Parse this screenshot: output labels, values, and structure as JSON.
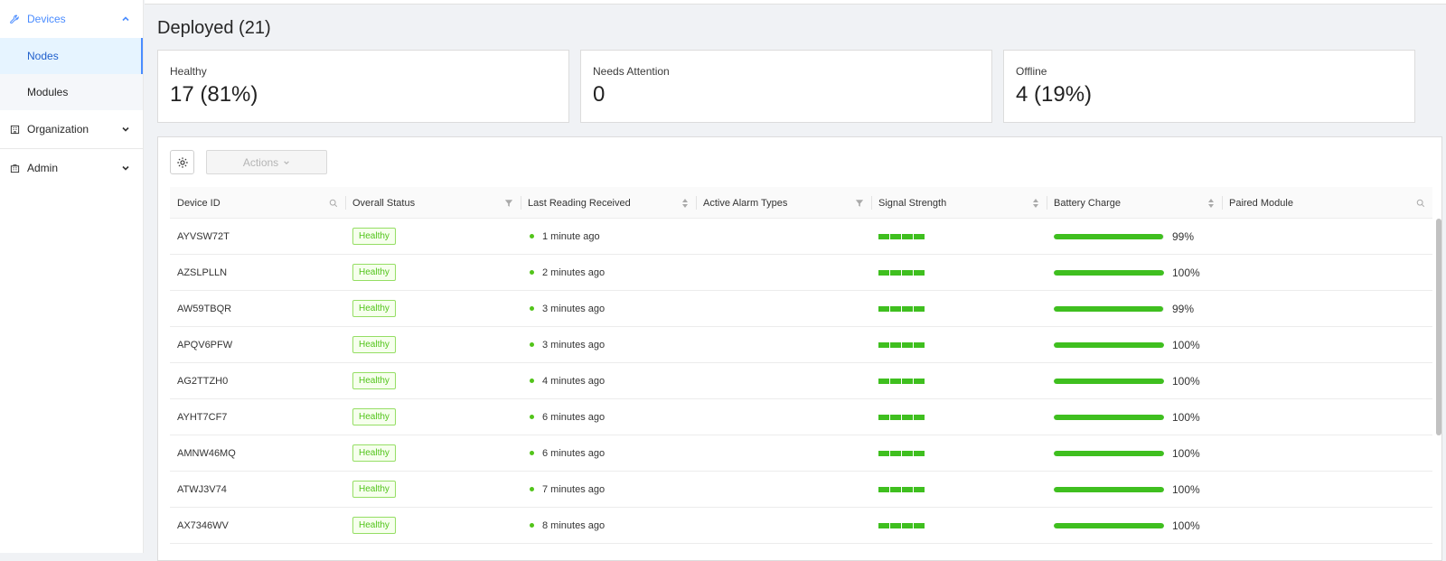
{
  "sidebar": {
    "devices": {
      "label": "Devices",
      "icon": "wrench-icon"
    },
    "nodes": {
      "label": "Nodes"
    },
    "modules": {
      "label": "Modules"
    },
    "organization": {
      "label": "Organization",
      "icon": "building-icon"
    },
    "admin": {
      "label": "Admin",
      "icon": "admin-building-icon"
    }
  },
  "page": {
    "title": "Deployed (21)"
  },
  "stats": {
    "healthy": {
      "label": "Healthy",
      "value": "17 (81%)"
    },
    "attention": {
      "label": "Needs Attention",
      "value": "0"
    },
    "offline": {
      "label": "Offline",
      "value": "4 (19%)"
    }
  },
  "toolbar": {
    "actions_label": "Actions"
  },
  "table": {
    "columns": {
      "device_id": "Device ID",
      "status": "Overall Status",
      "last_reading": "Last Reading Received",
      "alarms": "Active Alarm Types",
      "signal": "Signal Strength",
      "battery": "Battery Charge",
      "module": "Paired Module"
    },
    "rows": [
      {
        "device_id": "AYVSW72T",
        "status": "Healthy",
        "last_reading": "1 minute ago",
        "alarms": "",
        "signal_bars": 4,
        "battery": 0.99,
        "battery_label": "99%",
        "module": ""
      },
      {
        "device_id": "AZSLPLLN",
        "status": "Healthy",
        "last_reading": "2 minutes ago",
        "alarms": "",
        "signal_bars": 4,
        "battery": 1.0,
        "battery_label": "100%",
        "module": ""
      },
      {
        "device_id": "AW59TBQR",
        "status": "Healthy",
        "last_reading": "3 minutes ago",
        "alarms": "",
        "signal_bars": 4,
        "battery": 0.99,
        "battery_label": "99%",
        "module": ""
      },
      {
        "device_id": "APQV6PFW",
        "status": "Healthy",
        "last_reading": "3 minutes ago",
        "alarms": "",
        "signal_bars": 4,
        "battery": 1.0,
        "battery_label": "100%",
        "module": ""
      },
      {
        "device_id": "AG2TTZH0",
        "status": "Healthy",
        "last_reading": "4 minutes ago",
        "alarms": "",
        "signal_bars": 4,
        "battery": 1.0,
        "battery_label": "100%",
        "module": ""
      },
      {
        "device_id": "AYHT7CF7",
        "status": "Healthy",
        "last_reading": "6 minutes ago",
        "alarms": "",
        "signal_bars": 4,
        "battery": 1.0,
        "battery_label": "100%",
        "module": ""
      },
      {
        "device_id": "AMNW46MQ",
        "status": "Healthy",
        "last_reading": "6 minutes ago",
        "alarms": "",
        "signal_bars": 4,
        "battery": 1.0,
        "battery_label": "100%",
        "module": ""
      },
      {
        "device_id": "ATWJ3V74",
        "status": "Healthy",
        "last_reading": "7 minutes ago",
        "alarms": "",
        "signal_bars": 4,
        "battery": 1.0,
        "battery_label": "100%",
        "module": ""
      },
      {
        "device_id": "AX7346WV",
        "status": "Healthy",
        "last_reading": "8 minutes ago",
        "alarms": "",
        "signal_bars": 4,
        "battery": 1.0,
        "battery_label": "100%",
        "module": ""
      }
    ]
  },
  "colors": {
    "accent": "#4a8cff",
    "healthy_green": "#52c41a",
    "bar_green": "#3fbf1f"
  }
}
